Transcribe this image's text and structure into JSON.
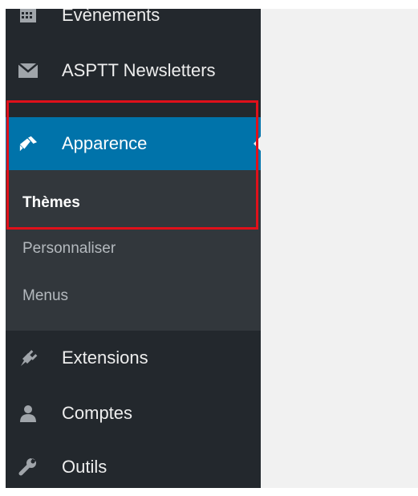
{
  "sidebar": {
    "items": [
      {
        "label": "Évènements",
        "icon": "calendar-icon"
      },
      {
        "label": "ASPTT Newsletters",
        "icon": "envelope-icon"
      },
      {
        "label": "Apparence",
        "icon": "paintbrush-icon",
        "active": true
      },
      {
        "label": "Extensions",
        "icon": "plugin-icon"
      },
      {
        "label": "Comptes",
        "icon": "user-icon"
      },
      {
        "label": "Outils",
        "icon": "wrench-icon"
      }
    ],
    "submenu": [
      {
        "label": "Thèmes",
        "current": true
      },
      {
        "label": "Personnaliser"
      },
      {
        "label": "Menus"
      }
    ]
  },
  "colors": {
    "sidebar_bg": "#23282d",
    "submenu_bg": "#32373c",
    "active_bg": "#0073aa",
    "highlight_border": "#e0101a",
    "content_bg": "#f1f1f1"
  }
}
